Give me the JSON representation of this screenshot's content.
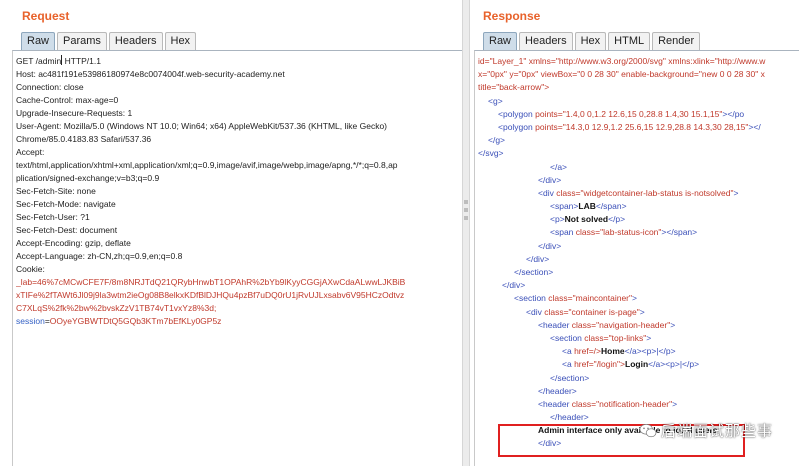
{
  "request": {
    "title": "Request",
    "tabs": [
      "Raw",
      "Params",
      "Headers",
      "Hex"
    ],
    "active_tab": "Raw",
    "lines": {
      "l0_prefix": "GET /admin",
      "l0_suffix": " HTTP/1.1",
      "l1": "Host: ac481f191e53986180974e8c0074004f.web-security-academy.net",
      "l2": "Connection: close",
      "l3": "Cache-Control: max-age=0",
      "l4": "Upgrade-Insecure-Requests: 1",
      "l5": "User-Agent: Mozilla/5.0 (Windows NT 10.0; Win64; x64) AppleWebKit/537.36 (KHTML, like Gecko)",
      "l6": "Chrome/85.0.4183.83 Safari/537.36",
      "l7": "Accept:",
      "l8": "text/html,application/xhtml+xml,application/xml;q=0.9,image/avif,image/webp,image/apng,*/*;q=0.8,ap",
      "l9": "plication/signed-exchange;v=b3;q=0.9",
      "l10": "Sec-Fetch-Site: none",
      "l11": "Sec-Fetch-Mode: navigate",
      "l12": "Sec-Fetch-User: ?1",
      "l13": "Sec-Fetch-Dest: document",
      "l14": "Accept-Encoding: gzip, deflate",
      "l15": "Accept-Language: zh-CN,zh;q=0.9,en;q=0.8",
      "l16": "Cookie:",
      "cookie_1": "_lab=46%7cMCwCFE7F/8m8NRJTdQ21QRybHnwbT1OPAhR%2bYb9lKyyCGGjAXwCdaALwwLJKBiB",
      "cookie_2": "xTIFe%2fTAWt6Jl09j9la3wtm2ieOg08B8elkxKDfBlDJHQu4pzBf7uDQ0rU1jRvUJLxsabv6V95HCzOdtvz",
      "cookie_3": "C7XLqS%2fk%2bw%2bvskZzV1TB74vT1vxYz8%3d;",
      "session_name": "session",
      "session_eq": "=",
      "session_value": "OOyeYGBWTDtQ5GQb3KTm7bEfKLy0GP5z"
    }
  },
  "response": {
    "title": "Response",
    "tabs": [
      "Raw",
      "Headers",
      "Hex",
      "HTML",
      "Render"
    ],
    "active_tab": "Raw",
    "lines": {
      "r0a": "id=\"Layer_1\" xmlns=\"http://www.w3.org/2000/svg\" xmlns:xlink=\"http://www.w",
      "r1a": "x=\"0px\" y=\"0px\" viewBox=\"0 0 28 30\" enable-background=\"new 0 0 28 30\" x",
      "r2a": "title=\"back-arrow\">",
      "r3": "<g>",
      "r4_tag": "<polygon ",
      "r4_attr": "points",
      "r4_val": "=\"1.4,0 0,1.2 12.6,15 0,28.8 1.4,30 15.1,15\"",
      "r4_end": "></po",
      "r5_tag": "<polygon ",
      "r5_attr": "points",
      "r5_val": "=\"14.3,0 12.9,1.2 25.6,15 12.9,28.8 14.3,30 28,15\"",
      "r5_end": "></",
      "r6": "</g>",
      "r7": "</svg>",
      "r8": "</a>",
      "r9": "</div>",
      "r10_tag": "<div ",
      "r10_attr": "class",
      "r10_val": "=\"widgetcontainer-lab-status is-notsolved\"",
      "r10_end": ">",
      "r11_open": "<span>",
      "r11_text": "LAB",
      "r11_close": "</span>",
      "r12_open": "<p>",
      "r12_text": "Not solved",
      "r12_close": "</p>",
      "r13_tag": "<span ",
      "r13_attr": "class",
      "r13_val": "=\"lab-status-icon\"",
      "r13_end": "></span>",
      "r14": "</div>",
      "r15": "</div>",
      "r16": "</section>",
      "r17": "</div>",
      "r18_tag": "<section ",
      "r18_attr": "class",
      "r18_val": "=\"maincontainer\"",
      "r18_end": ">",
      "r19_tag": "<div ",
      "r19_attr": "class",
      "r19_val": "=\"container is-page\"",
      "r19_end": ">",
      "r20_tag": "<header ",
      "r20_attr": "class",
      "r20_val": "=\"navigation-header\"",
      "r20_end": ">",
      "r21_tag": "<section ",
      "r21_attr": "class",
      "r21_val": "=\"top-links\"",
      "r21_end": ">",
      "r22_tag": "<a ",
      "r22_attr": "href",
      "r22_val": "=/>",
      "r22_text": "Home",
      "r22_end": "</a><p>|</p>",
      "r23_tag": "<a ",
      "r23_attr": "href",
      "r23_val": "=\"/login\">",
      "r23_text": "Login",
      "r23_end": "</a><p>|</p>",
      "r24": "</section>",
      "r25": "</header>",
      "r26_tag": "<header ",
      "r26_attr": "class",
      "r26_val": "=\"notification-header\"",
      "r26_end": ">",
      "r27": "</header>",
      "r28_text": "Admin interface only available to local users",
      "r29": "</div>"
    }
  },
  "watermark": {
    "text": "后端面试那些事",
    "icon": "wechat-icon"
  },
  "colors": {
    "title_orange": "#e8622b",
    "highlight_red": "#e02020",
    "tag_blue": "#3a4fb8",
    "attr_red": "#c0392b"
  }
}
